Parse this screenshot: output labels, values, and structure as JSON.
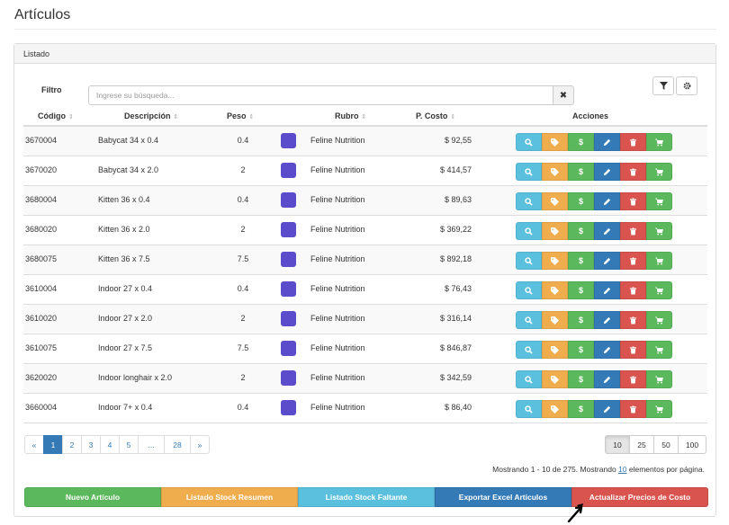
{
  "page": {
    "title": "Artículos"
  },
  "panel": {
    "heading": "Listado"
  },
  "filter": {
    "label": "Filtro",
    "placeholder": "Ingrese su búsqueda...",
    "value": "",
    "clear_glyph": "✖"
  },
  "toolbar": {
    "filter_icon": "filter-icon",
    "settings_icon": "gear-icon"
  },
  "table": {
    "columns": {
      "codigo": "Código",
      "descripcion": "Descripción",
      "peso": "Peso",
      "rubro": "Rubro",
      "costo": "P. Costo",
      "acciones": "Acciones"
    },
    "sort_glyph": "⇕",
    "rows": [
      {
        "codigo": "3670004",
        "descripcion": "Babycat 34 x 0.4",
        "peso": "0.4",
        "rubro": "Feline Nutrition",
        "costo": "$ 92,55"
      },
      {
        "codigo": "3670020",
        "descripcion": "Babycat 34 x 2.0",
        "peso": "2",
        "rubro": "Feline Nutrition",
        "costo": "$ 414,57"
      },
      {
        "codigo": "3680004",
        "descripcion": "Kitten 36 x 0.4",
        "peso": "0.4",
        "rubro": "Feline Nutrition",
        "costo": "$ 89,63"
      },
      {
        "codigo": "3680020",
        "descripcion": "Kitten 36 x 2.0",
        "peso": "2",
        "rubro": "Feline Nutrition",
        "costo": "$ 369,22"
      },
      {
        "codigo": "3680075",
        "descripcion": "Kitten 36 x 7.5",
        "peso": "7.5",
        "rubro": "Feline Nutrition",
        "costo": "$ 892,18"
      },
      {
        "codigo": "3610004",
        "descripcion": "Indoor 27 x 0.4",
        "peso": "0.4",
        "rubro": "Feline Nutrition",
        "costo": "$ 76,43"
      },
      {
        "codigo": "3610020",
        "descripcion": "Indoor 27 x 2.0",
        "peso": "2",
        "rubro": "Feline Nutrition",
        "costo": "$ 316,14"
      },
      {
        "codigo": "3610075",
        "descripcion": "Indoor 27 x 7.5",
        "peso": "7.5",
        "rubro": "Feline Nutrition",
        "costo": "$ 846,87"
      },
      {
        "codigo": "3620020",
        "descripcion": "Indoor longhair x 2.0",
        "peso": "2",
        "rubro": "Feline Nutrition",
        "costo": "$ 342,59"
      },
      {
        "codigo": "3660004",
        "descripcion": "Indoor 7+ x 0.4",
        "peso": "0.4",
        "rubro": "Feline Nutrition",
        "costo": "$ 86,40"
      }
    ],
    "swatch_color": "#5b4ccc",
    "actions": [
      {
        "icon": "search-icon",
        "color": "#5bc0de",
        "glyph": ""
      },
      {
        "icon": "tag-icon",
        "color": "#f0ad4e",
        "glyph": ""
      },
      {
        "icon": "dollar-icon",
        "color": "#5cb85c",
        "glyph": "$"
      },
      {
        "icon": "pencil-icon",
        "color": "#337ab7",
        "glyph": ""
      },
      {
        "icon": "trash-icon",
        "color": "#d9534f",
        "glyph": ""
      },
      {
        "icon": "cart-icon",
        "color": "#5cb85c",
        "glyph": ""
      }
    ]
  },
  "pagination": {
    "prev": "«",
    "pages": [
      "1",
      "2",
      "3",
      "4",
      "5",
      "...",
      "28"
    ],
    "active": "1",
    "next": "»"
  },
  "page_size": {
    "options": [
      "10",
      "25",
      "50",
      "100"
    ],
    "active": "10"
  },
  "summary": {
    "prefix": "Mostrando 1 - 10 de 275. Mostrando ",
    "per_page": "10",
    "suffix": " elementos por página."
  },
  "bottom_buttons": [
    {
      "label": "Nuevo Artículo",
      "color": "#5cb85c"
    },
    {
      "label": "Listado Stock Resumen",
      "color": "#f0ad4e"
    },
    {
      "label": "Listado Stock Faltante",
      "color": "#5bc0de"
    },
    {
      "label": "Exportar Excel Articulos",
      "color": "#337ab7"
    },
    {
      "label": "Actualizar Precios de Costo",
      "color": "#d9534f"
    }
  ]
}
